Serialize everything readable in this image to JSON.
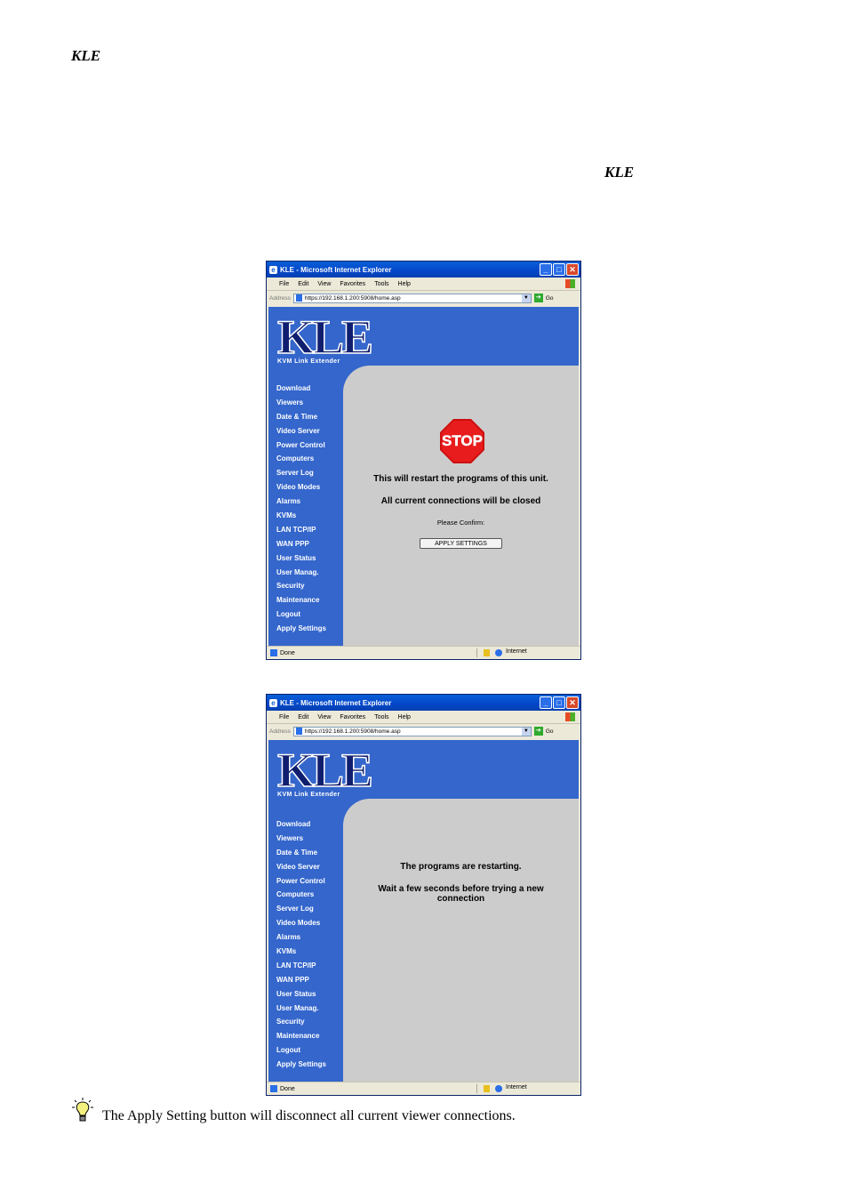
{
  "doc": {
    "kle_top": "KLE",
    "kle_mid": "KLE",
    "tip_text": "The Apply Setting button will disconnect all current viewer connections."
  },
  "browser": {
    "title": "KLE - Microsoft Internet Explorer",
    "menu": [
      "File",
      "Edit",
      "View",
      "Favorites",
      "Tools",
      "Help"
    ],
    "address_label": "Address",
    "url": "https://192.168.1.200:5908/home.asp",
    "go_label": "Go",
    "status": "Done",
    "zone": "Internet"
  },
  "logo": {
    "text": "KLE",
    "tagline": "KVM Link Extender"
  },
  "nav": [
    "Download",
    "Viewers",
    "Date & Time",
    "Video Server",
    "Power Control",
    "Computers",
    "Server Log",
    "Video Modes",
    "Alarms",
    "KVMs",
    "LAN TCP/IP",
    "WAN PPP",
    "User Status",
    "User Manag.",
    "Security",
    "Maintenance",
    "Logout",
    "Apply Settings"
  ],
  "screen1": {
    "stop_sign": "STOP",
    "line1": "This will restart the programs of this unit.",
    "line2": "All current connections will be closed",
    "confirm": "Please Confirm:",
    "button": "APPLY SETTINGS"
  },
  "screen2": {
    "line1": "The programs are restarting.",
    "line2": "Wait a few seconds before trying a new connection"
  }
}
